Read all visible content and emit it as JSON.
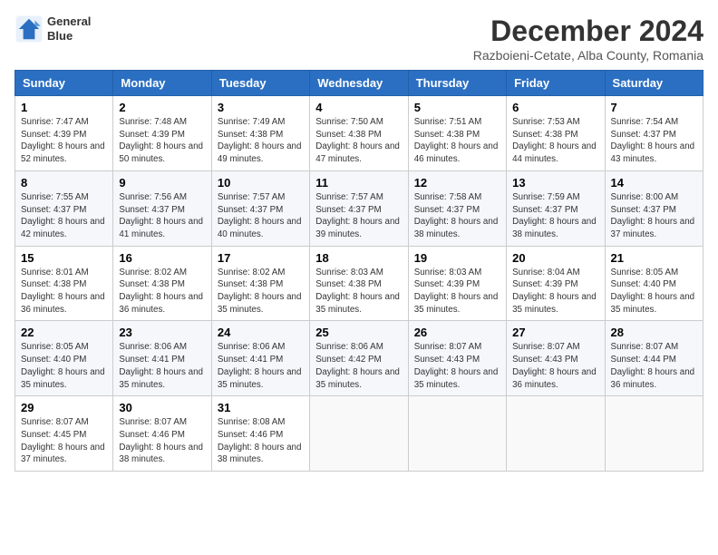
{
  "header": {
    "logo_line1": "General",
    "logo_line2": "Blue",
    "month": "December 2024",
    "location": "Razboieni-Cetate, Alba County, Romania"
  },
  "days_of_week": [
    "Sunday",
    "Monday",
    "Tuesday",
    "Wednesday",
    "Thursday",
    "Friday",
    "Saturday"
  ],
  "weeks": [
    [
      {
        "day": "1",
        "sunrise": "7:47 AM",
        "sunset": "4:39 PM",
        "daylight": "8 hours and 52 minutes."
      },
      {
        "day": "2",
        "sunrise": "7:48 AM",
        "sunset": "4:39 PM",
        "daylight": "8 hours and 50 minutes."
      },
      {
        "day": "3",
        "sunrise": "7:49 AM",
        "sunset": "4:38 PM",
        "daylight": "8 hours and 49 minutes."
      },
      {
        "day": "4",
        "sunrise": "7:50 AM",
        "sunset": "4:38 PM",
        "daylight": "8 hours and 47 minutes."
      },
      {
        "day": "5",
        "sunrise": "7:51 AM",
        "sunset": "4:38 PM",
        "daylight": "8 hours and 46 minutes."
      },
      {
        "day": "6",
        "sunrise": "7:53 AM",
        "sunset": "4:38 PM",
        "daylight": "8 hours and 44 minutes."
      },
      {
        "day": "7",
        "sunrise": "7:54 AM",
        "sunset": "4:37 PM",
        "daylight": "8 hours and 43 minutes."
      }
    ],
    [
      {
        "day": "8",
        "sunrise": "7:55 AM",
        "sunset": "4:37 PM",
        "daylight": "8 hours and 42 minutes."
      },
      {
        "day": "9",
        "sunrise": "7:56 AM",
        "sunset": "4:37 PM",
        "daylight": "8 hours and 41 minutes."
      },
      {
        "day": "10",
        "sunrise": "7:57 AM",
        "sunset": "4:37 PM",
        "daylight": "8 hours and 40 minutes."
      },
      {
        "day": "11",
        "sunrise": "7:57 AM",
        "sunset": "4:37 PM",
        "daylight": "8 hours and 39 minutes."
      },
      {
        "day": "12",
        "sunrise": "7:58 AM",
        "sunset": "4:37 PM",
        "daylight": "8 hours and 38 minutes."
      },
      {
        "day": "13",
        "sunrise": "7:59 AM",
        "sunset": "4:37 PM",
        "daylight": "8 hours and 38 minutes."
      },
      {
        "day": "14",
        "sunrise": "8:00 AM",
        "sunset": "4:37 PM",
        "daylight": "8 hours and 37 minutes."
      }
    ],
    [
      {
        "day": "15",
        "sunrise": "8:01 AM",
        "sunset": "4:38 PM",
        "daylight": "8 hours and 36 minutes."
      },
      {
        "day": "16",
        "sunrise": "8:02 AM",
        "sunset": "4:38 PM",
        "daylight": "8 hours and 36 minutes."
      },
      {
        "day": "17",
        "sunrise": "8:02 AM",
        "sunset": "4:38 PM",
        "daylight": "8 hours and 35 minutes."
      },
      {
        "day": "18",
        "sunrise": "8:03 AM",
        "sunset": "4:38 PM",
        "daylight": "8 hours and 35 minutes."
      },
      {
        "day": "19",
        "sunrise": "8:03 AM",
        "sunset": "4:39 PM",
        "daylight": "8 hours and 35 minutes."
      },
      {
        "day": "20",
        "sunrise": "8:04 AM",
        "sunset": "4:39 PM",
        "daylight": "8 hours and 35 minutes."
      },
      {
        "day": "21",
        "sunrise": "8:05 AM",
        "sunset": "4:40 PM",
        "daylight": "8 hours and 35 minutes."
      }
    ],
    [
      {
        "day": "22",
        "sunrise": "8:05 AM",
        "sunset": "4:40 PM",
        "daylight": "8 hours and 35 minutes."
      },
      {
        "day": "23",
        "sunrise": "8:06 AM",
        "sunset": "4:41 PM",
        "daylight": "8 hours and 35 minutes."
      },
      {
        "day": "24",
        "sunrise": "8:06 AM",
        "sunset": "4:41 PM",
        "daylight": "8 hours and 35 minutes."
      },
      {
        "day": "25",
        "sunrise": "8:06 AM",
        "sunset": "4:42 PM",
        "daylight": "8 hours and 35 minutes."
      },
      {
        "day": "26",
        "sunrise": "8:07 AM",
        "sunset": "4:43 PM",
        "daylight": "8 hours and 35 minutes."
      },
      {
        "day": "27",
        "sunrise": "8:07 AM",
        "sunset": "4:43 PM",
        "daylight": "8 hours and 36 minutes."
      },
      {
        "day": "28",
        "sunrise": "8:07 AM",
        "sunset": "4:44 PM",
        "daylight": "8 hours and 36 minutes."
      }
    ],
    [
      {
        "day": "29",
        "sunrise": "8:07 AM",
        "sunset": "4:45 PM",
        "daylight": "8 hours and 37 minutes."
      },
      {
        "day": "30",
        "sunrise": "8:07 AM",
        "sunset": "4:46 PM",
        "daylight": "8 hours and 38 minutes."
      },
      {
        "day": "31",
        "sunrise": "8:08 AM",
        "sunset": "4:46 PM",
        "daylight": "8 hours and 38 minutes."
      },
      null,
      null,
      null,
      null
    ]
  ]
}
